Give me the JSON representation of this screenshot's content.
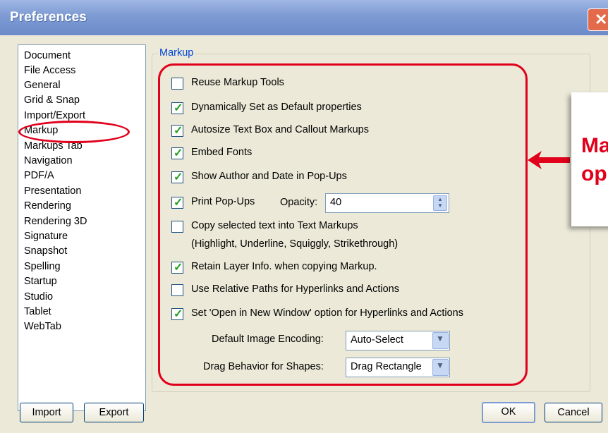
{
  "window": {
    "title": "Preferences",
    "close_symbol": "✕"
  },
  "categories": [
    "Document",
    "File Access",
    "General",
    "Grid & Snap",
    "Import/Export",
    "Markup",
    "Markups Tab",
    "Navigation",
    "PDF/A",
    "Presentation",
    "Rendering",
    "Rendering 3D",
    "Signature",
    "Snapshot",
    "Spelling",
    "Startup",
    "Studio",
    "Tablet",
    "WebTab"
  ],
  "selected_category": "Markup",
  "group_title": "Markup",
  "options": [
    {
      "label": "Reuse Markup Tools",
      "checked": false
    },
    {
      "label": "Dynamically Set as Default properties",
      "checked": true
    },
    {
      "label": "Autosize Text Box and Callout Markups",
      "checked": true
    },
    {
      "label": "Embed Fonts",
      "checked": true
    },
    {
      "label": "Show Author and Date in Pop-Ups",
      "checked": true
    },
    {
      "label": "Print Pop-Ups",
      "checked": true
    },
    {
      "label": "Copy selected text into Text Markups",
      "checked": false
    },
    {
      "label": "Retain Layer Info. when copying Markup.",
      "checked": true
    },
    {
      "label": "Use Relative Paths for Hyperlinks and Actions",
      "checked": false
    },
    {
      "label": "Set 'Open in New Window' option for Hyperlinks and Actions",
      "checked": true
    }
  ],
  "copy_text_sublabel": "(Highlight, Underline, Squiggly, Strikethrough)",
  "opacity": {
    "label": "Opacity:",
    "value": "40",
    "spin_up": "▲",
    "spin_down": "▼"
  },
  "image_encoding": {
    "label": "Default Image Encoding:",
    "value": "Auto-Select"
  },
  "drag_behavior": {
    "label": "Drag Behavior for Shapes:",
    "value": "Drag Rectangle"
  },
  "dropdown_arrow": "▼",
  "check_mark": "✓",
  "buttons": {
    "import": "Import",
    "export": "Export",
    "ok": "OK",
    "cancel": "Cancel"
  },
  "annotation": {
    "callout_text": "Ma\nop",
    "color": "#e0001b"
  }
}
